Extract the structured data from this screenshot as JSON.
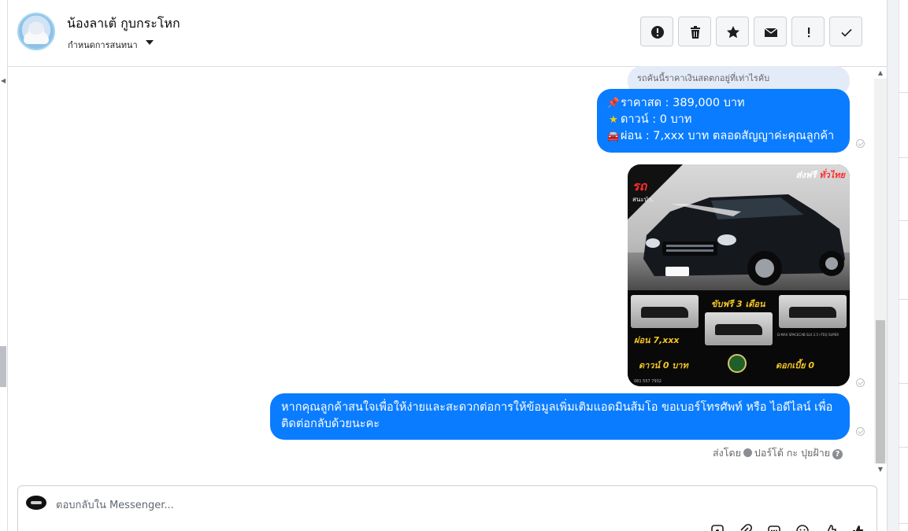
{
  "header": {
    "contact_name": "น้องลาเต้ กูบกระโหก",
    "conversation_label": "กำหนดการสนทนา",
    "actions": [
      {
        "name": "mark-spam",
        "icon": "alert-circle-icon"
      },
      {
        "name": "delete",
        "icon": "trash-icon"
      },
      {
        "name": "star",
        "icon": "star-icon"
      },
      {
        "name": "mark-unread",
        "icon": "envelope-icon"
      },
      {
        "name": "follow-up",
        "icon": "exclamation-icon"
      },
      {
        "name": "mark-done",
        "icon": "check-icon"
      }
    ]
  },
  "messages": {
    "reply_preview": "รถคันนี้ราคาเงินสดตกอยู่ที่เท่าไรคับ",
    "price_lines": [
      {
        "icon": "pin-icon",
        "text": "ราคาสด : 389,000 บาท"
      },
      {
        "icon": "star-icon",
        "text": "ดาวน์ : 0 บาท"
      },
      {
        "icon": "car-icon",
        "text": "ผ่อน : 7,xxx บาท ตลอดสัญญาค่ะคุณลูกค้า"
      }
    ],
    "ad_image": {
      "badge": "รถ",
      "badge_sub": "สนะป่า.",
      "shipping_prefix": "ส่งฟรี",
      "shipping_highlight": "ทั่วไทย",
      "headline": "ขับฟรี 3 เดือน",
      "installment": "ผ่อน 7,xxx",
      "down_payment": "ดาวน์ 0 บาท",
      "interest": "ดอกเบี้ย 0",
      "model_text": "D-MAX SPACECAB SLX 2.5 i-TEQ SUPER",
      "contact_small": "081 557 7932"
    },
    "contact_message": "หากคุณลูกค้าสนใจเพื่อให้ง่ายและสะดวกต่อการให้ข้อมูลเพิ่มเติมแอดมินส้มโอ ขอเบอร์โทรศัพท์ หรือ ไอดีไลน์ เพื่อติดต่อกลับด้วยนะคะ",
    "sent_by_prefix": "ส่งโดย",
    "sent_by_name": "ปอร์โต้ กะ ปุยฝ้าย"
  },
  "composer": {
    "placeholder": "ตอบกลับใน Messenger...",
    "tools": [
      "sticker-icon",
      "attachment-icon",
      "saved-reply-icon",
      "emoji-icon",
      "thumbs-icon",
      "like-icon"
    ]
  },
  "colors": {
    "bubble": "#0a7cff",
    "reply_preview_bg": "#e4ebf8",
    "gold": "#f3c623",
    "brand_red": "#ff2b2b"
  }
}
